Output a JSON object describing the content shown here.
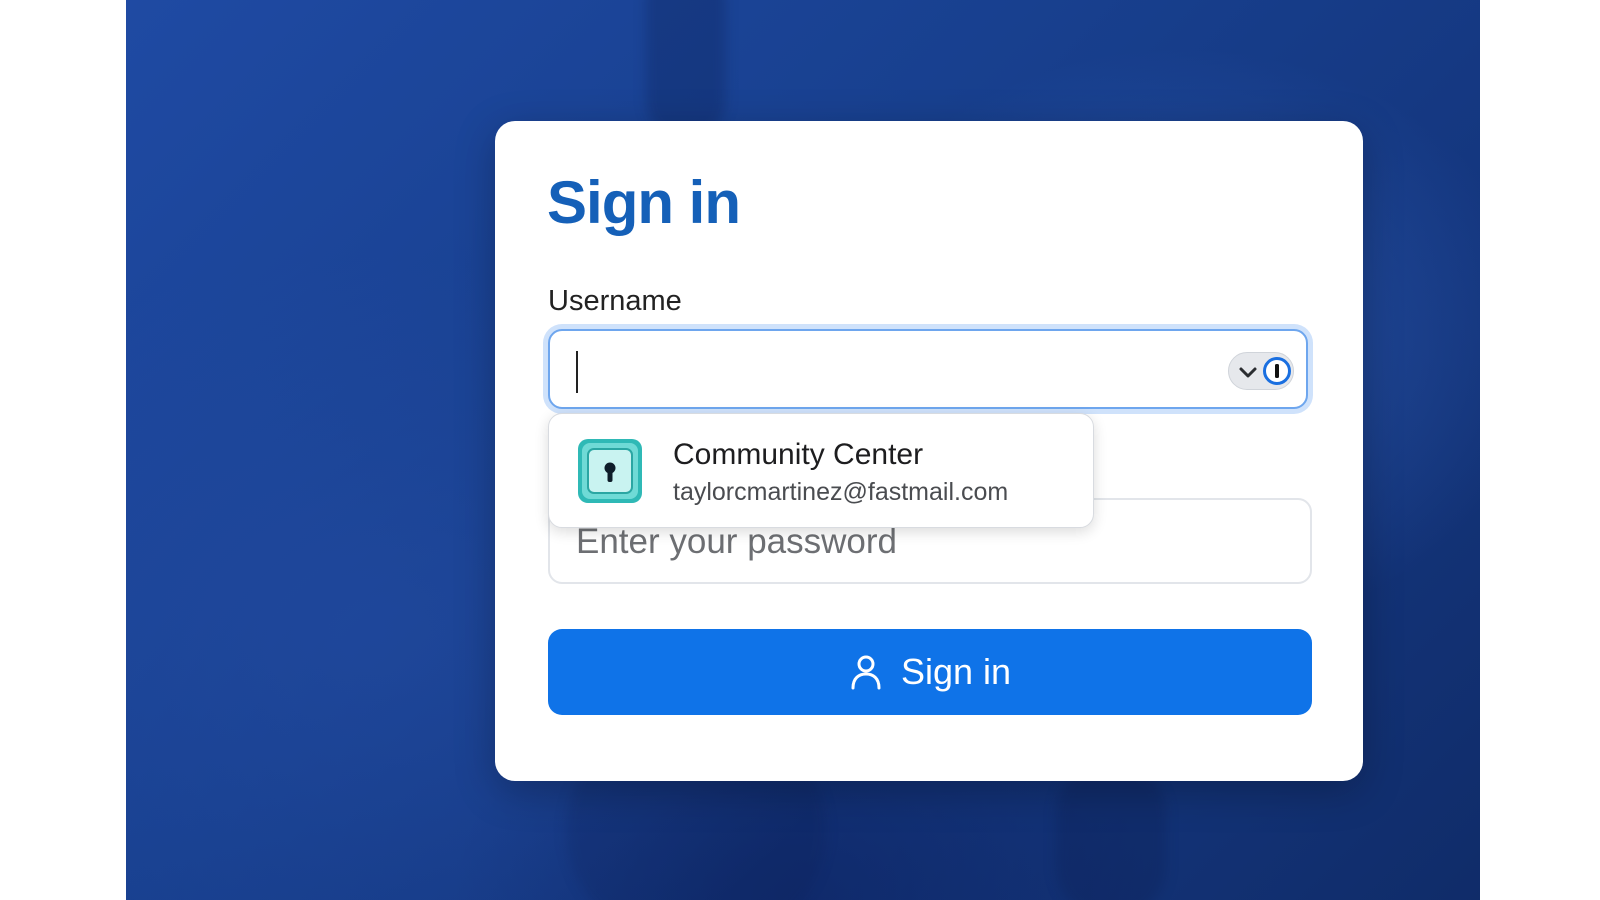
{
  "form": {
    "title": "Sign in",
    "username_label": "Username",
    "username_value": "",
    "password_placeholder": "Enter your password",
    "submit_label": "Sign in"
  },
  "autofill": {
    "icon": "chevron-down-icon",
    "brand_icon": "1password-icon"
  },
  "suggestion": {
    "title": "Community Center",
    "subtitle": "taylorcmartinez@fastmail.com",
    "icon": "keyhole-icon"
  },
  "colors": {
    "primary": "#0f73e8",
    "title": "#1560b8",
    "focus_ring": "#cfe2fb",
    "vault_teal": "#37c4c0"
  }
}
